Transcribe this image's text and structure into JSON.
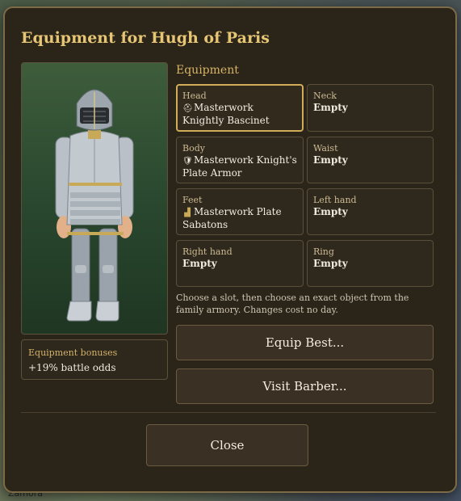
{
  "background_label": "Zamora",
  "dialog": {
    "title": "Equipment for Hugh of Paris",
    "section_label": "Equipment",
    "bonus": {
      "title": "Equipment bonuses",
      "value": "+19% battle odds"
    },
    "slots": [
      {
        "label": "Head",
        "value": "Masterwork Knightly Bascinet",
        "icon": "helmet-icon",
        "selected": true
      },
      {
        "label": "Neck",
        "value": "Empty"
      },
      {
        "label": "Body",
        "value": "Masterwork Knight's Plate Armor",
        "icon": "shield-icon"
      },
      {
        "label": "Waist",
        "value": "Empty"
      },
      {
        "label": "Feet",
        "value": "Masterwork Plate Sabatons",
        "icon": "boot-icon"
      },
      {
        "label": "Left hand",
        "value": "Empty"
      },
      {
        "label": "Right hand",
        "value": "Empty"
      },
      {
        "label": "Ring",
        "value": "Empty"
      }
    ],
    "hint": "Choose a slot, then choose an exact object from the family armory. Changes cost no day.",
    "equip_best_label": "Equip Best...",
    "visit_barber_label": "Visit Barber...",
    "close_label": "Close"
  },
  "colors": {
    "accent": "#e6c675",
    "panel": "#2b2419",
    "border": "#7d6a47"
  }
}
